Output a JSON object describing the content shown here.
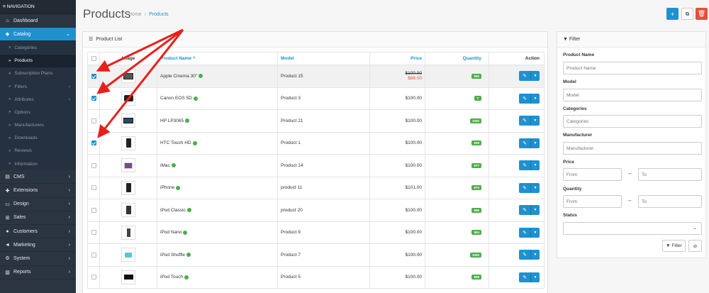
{
  "nav": {
    "heading": "≡ NAVIGATION",
    "items": [
      {
        "label": "Dashboard",
        "icon": "dashboard-icon",
        "glyph": "⌂",
        "chevron": false
      },
      {
        "label": "Catalog",
        "icon": "tag-icon",
        "glyph": "◆",
        "chevron": true,
        "active": true
      }
    ],
    "catalog_sub": [
      {
        "label": "Categories"
      },
      {
        "label": "Products",
        "active": true
      },
      {
        "label": "Subscription Plans"
      },
      {
        "label": "Filters",
        "chevron": true
      },
      {
        "label": "Attributes",
        "chevron": true
      },
      {
        "label": "Options"
      },
      {
        "label": "Manufacturers"
      },
      {
        "label": "Downloads"
      },
      {
        "label": "Reviews"
      },
      {
        "label": "Information"
      }
    ],
    "items_after": [
      {
        "label": "CMS",
        "icon": "cms-icon",
        "glyph": "▤"
      },
      {
        "label": "Extensions",
        "icon": "puzzle-icon",
        "glyph": "✚"
      },
      {
        "label": "Design",
        "icon": "monitor-icon",
        "glyph": "▭"
      },
      {
        "label": "Sales",
        "icon": "cart-icon",
        "glyph": "⊞"
      },
      {
        "label": "Customers",
        "icon": "user-icon",
        "glyph": "●"
      },
      {
        "label": "Marketing",
        "icon": "share-icon",
        "glyph": "◄"
      },
      {
        "label": "System",
        "icon": "gear-icon",
        "glyph": "⚙"
      },
      {
        "label": "Reports",
        "icon": "bar-chart-icon",
        "glyph": "▥"
      }
    ]
  },
  "header": {
    "title": "Products",
    "breadcrumb": [
      "Home",
      "Products"
    ],
    "breadcrumb_sep": "›"
  },
  "list": {
    "heading": "Product List",
    "columns": {
      "image": "Image",
      "name": "Product Name ^",
      "model": "Model",
      "price": "Price",
      "quantity": "Quantity",
      "action": "Action"
    },
    "rows": [
      {
        "checked": true,
        "name": "Apple Cinema 30\"",
        "model": "Product 15",
        "price": "$100.00",
        "special": "$88.00",
        "qty": "990",
        "thumb": "monitor"
      },
      {
        "checked": true,
        "name": "Canon EOS 5D",
        "model": "Product 3",
        "price": "$100.00",
        "special": "",
        "qty": "7",
        "thumb": "camera"
      },
      {
        "checked": false,
        "name": "HP LP3065",
        "model": "Product 21",
        "price": "$100.00",
        "special": "",
        "qty": "1000",
        "thumb": "laptop"
      },
      {
        "checked": true,
        "name": "HTC Touch HD",
        "model": "Product 1",
        "price": "$100.00",
        "special": "",
        "qty": "939",
        "thumb": "phone"
      },
      {
        "checked": false,
        "name": "iMac",
        "model": "Product 14",
        "price": "$100.00",
        "special": "",
        "qty": "977",
        "thumb": "imac"
      },
      {
        "checked": false,
        "name": "iPhone",
        "model": "product 11",
        "price": "$101.00",
        "special": "",
        "qty": "970",
        "thumb": "phone"
      },
      {
        "checked": false,
        "name": "iPod Classic",
        "model": "product 20",
        "price": "$100.00",
        "special": "",
        "qty": "995",
        "thumb": "ipod"
      },
      {
        "checked": false,
        "name": "iPod Nano",
        "model": "Product 9",
        "price": "$100.00",
        "special": "",
        "qty": "994",
        "thumb": "nano"
      },
      {
        "checked": false,
        "name": "iPod Shuffle",
        "model": "Product 7",
        "price": "$100.00",
        "special": "",
        "qty": "1000",
        "thumb": "shuffle"
      },
      {
        "checked": false,
        "name": "iPod Touch",
        "model": "Product 5",
        "price": "$100.00",
        "special": "",
        "qty": "999",
        "thumb": "touch"
      }
    ]
  },
  "filter": {
    "heading": "Filter",
    "product_name_label": "Product Name",
    "product_name_placeholder": "Product Name",
    "model_label": "Model",
    "model_placeholder": "Model",
    "categories_label": "Categories",
    "categories_placeholder": "Categories",
    "manufacturer_label": "Manufacturer",
    "manufacturer_placeholder": "Manufacturer",
    "price_label": "Price",
    "price_from": "From",
    "price_to": "To",
    "quantity_label": "Quantity",
    "qty_from": "From",
    "qty_to": "To",
    "status_label": "Status",
    "filter_button": "Filter",
    "range_sep": "–"
  },
  "colors": {
    "accent": "#1e91cf",
    "danger": "#e3503e",
    "success": "#4cae4c",
    "sidebar": "#2b3441",
    "annotation_arrow": "#e8201a"
  }
}
